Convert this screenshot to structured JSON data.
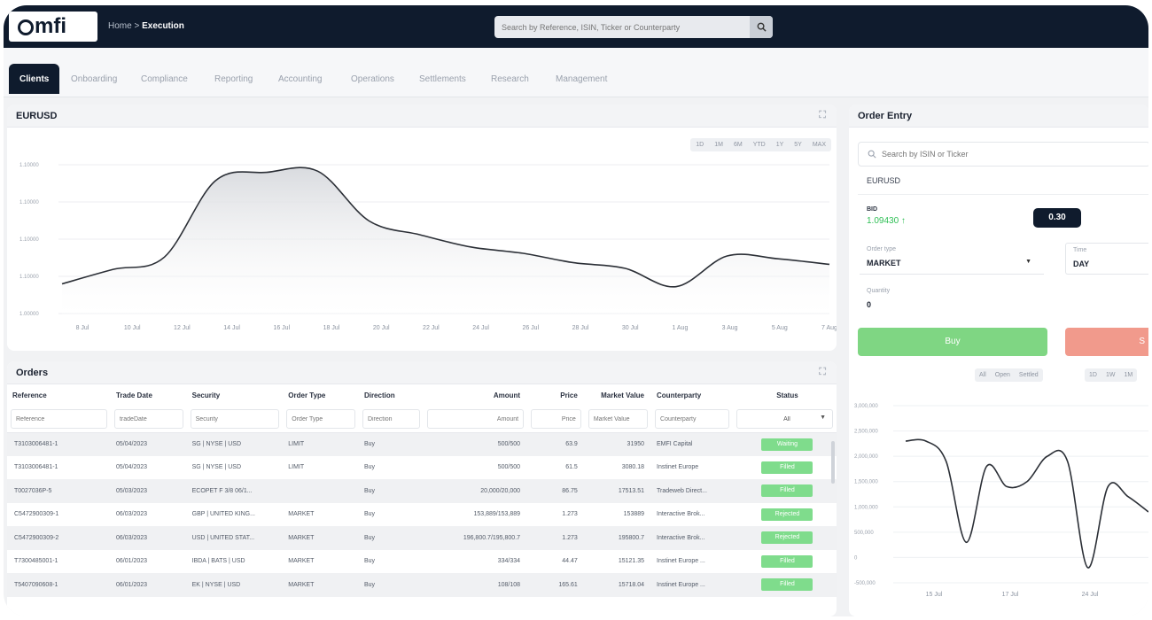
{
  "header": {
    "logo_text": "mfi",
    "breadcrumb_home": "Home",
    "breadcrumb_sep": " > ",
    "breadcrumb_current": "Execution",
    "search_placeholder": "Search by Reference, ISIN, Ticker or Counterparty",
    "search_icon": "search-icon"
  },
  "tabs": [
    {
      "label": "Clients",
      "active": true
    },
    {
      "label": "Onboarding"
    },
    {
      "label": "Compliance"
    },
    {
      "label": "Reporting"
    },
    {
      "label": "Accounting"
    },
    {
      "label": "Operations"
    },
    {
      "label": "Settlements"
    },
    {
      "label": "Research"
    },
    {
      "label": "Management"
    }
  ],
  "chart_panel": {
    "title": "EURUSD",
    "ranges": [
      "1D",
      "1M",
      "6M",
      "YTD",
      "1Y",
      "5Y",
      "MAX"
    ]
  },
  "chart_data": [
    {
      "type": "area",
      "title": "EURUSD",
      "x": [
        "8 Jul",
        "10 Jul",
        "12 Jul",
        "14 Jul",
        "16 Jul",
        "18 Jul",
        "20 Jul",
        "22 Jul",
        "24 Jul",
        "26 Jul",
        "28 Jul",
        "30 Jul",
        "1 Aug",
        "3 Aug",
        "5 Aug",
        "7 Aug"
      ],
      "yticks": [
        "1.10000",
        "1.10000",
        "1.10000",
        "1.10000",
        "1.00000"
      ],
      "values": [
        1.0004,
        1.00066,
        1.00088,
        1.00225,
        1.0024,
        1.00242,
        1.00153,
        1.00128,
        1.00106,
        1.00095,
        1.00078,
        1.00068,
        1.00035,
        1.0009,
        1.00085,
        1.00075
      ],
      "grid": true
    },
    {
      "type": "line",
      "yticks": [
        "3,000,000",
        "2,500,000",
        "2,000,000",
        "1,500,000",
        "1,000,000",
        "500,000",
        "0",
        "-500,000"
      ],
      "x": [
        "15 Jul",
        "17 Jul",
        "24 Jul"
      ],
      "values": [
        2300000,
        2300000,
        1900000,
        300000,
        1800000,
        1400000,
        1500000,
        2000000,
        1900000,
        -200000,
        1400000,
        1200000,
        900000
      ],
      "grid": true
    }
  ],
  "orders": {
    "title": "Orders",
    "columns": [
      "Reference",
      "Trade Date",
      "Security",
      "Order Type",
      "Direction",
      "Amount",
      "Price",
      "Market Value",
      "Counterparty",
      "Status"
    ],
    "filters": [
      "Reference",
      "tradeDate",
      "Security",
      "Order Type",
      "Direction",
      "Amount",
      "Price",
      "Market Value",
      "Counterparty",
      "All"
    ],
    "rows": [
      [
        "T3103006481-1",
        "05/04/2023",
        "SG | NYSE | USD",
        "LIMIT",
        "Buy",
        "500/500",
        "63.9",
        "31950",
        "EMFI Capital",
        "Waiting"
      ],
      [
        "T3103006481-1",
        "05/04/2023",
        "SG | NYSE | USD",
        "LIMIT",
        "Buy",
        "500/500",
        "61.5",
        "3080.18",
        "Instinet Europe",
        "Filled"
      ],
      [
        "T0027036P-5",
        "05/03/2023",
        "ECOPET F 3/8 06/1...",
        "",
        "Buy",
        "20,000/20,000",
        "86.75",
        "17513.51",
        "Tradeweb Direct...",
        "Filled"
      ],
      [
        "C5472900309-1",
        "06/03/2023",
        "GBP | UNITED KING...",
        "MARKET",
        "Buy",
        "153,889/153,889",
        "1.273",
        "153889",
        "Interactive Brok...",
        "Rejected"
      ],
      [
        "C5472900309-2",
        "06/03/2023",
        "USD | UNITED STAT...",
        "MARKET",
        "Buy",
        "196,800.7/195,800.7",
        "1.273",
        "195800.7",
        "Interactive Brok...",
        "Rejected"
      ],
      [
        "T7300485001-1",
        "06/01/2023",
        "IBDA | BATS | USD",
        "MARKET",
        "Buy",
        "334/334",
        "44.47",
        "15121.35",
        "Instinet Europe ...",
        "Filled"
      ],
      [
        "T5407090608-1",
        "06/01/2023",
        "EK | NYSE | USD",
        "MARKET",
        "Buy",
        "108/108",
        "165.61",
        "15718.04",
        "Instinet Europe ...",
        "Filled"
      ]
    ]
  },
  "order_entry": {
    "title": "Order Entry",
    "search_placeholder": "Search by ISIN or Ticker",
    "instrument": "EURUSD",
    "bid_label": "BID",
    "bid_value": "1.09430 ↑",
    "spread": "0.30",
    "order_type_label": "Order type",
    "order_type_value": "MARKET",
    "time_label": "Time",
    "time_value": "DAY",
    "quantity_label": "Quantity",
    "quantity_value": "0",
    "buy_label": "Buy",
    "sell_label": "S",
    "filters": [
      "All",
      "Open",
      "Settled"
    ],
    "ranges": [
      "1D",
      "1W",
      "1M"
    ],
    "colors": {
      "buy": "#7fd683",
      "sell": "#f19a8c",
      "accent_green": "#2fbf55",
      "navy": "#0f1b2d"
    }
  }
}
